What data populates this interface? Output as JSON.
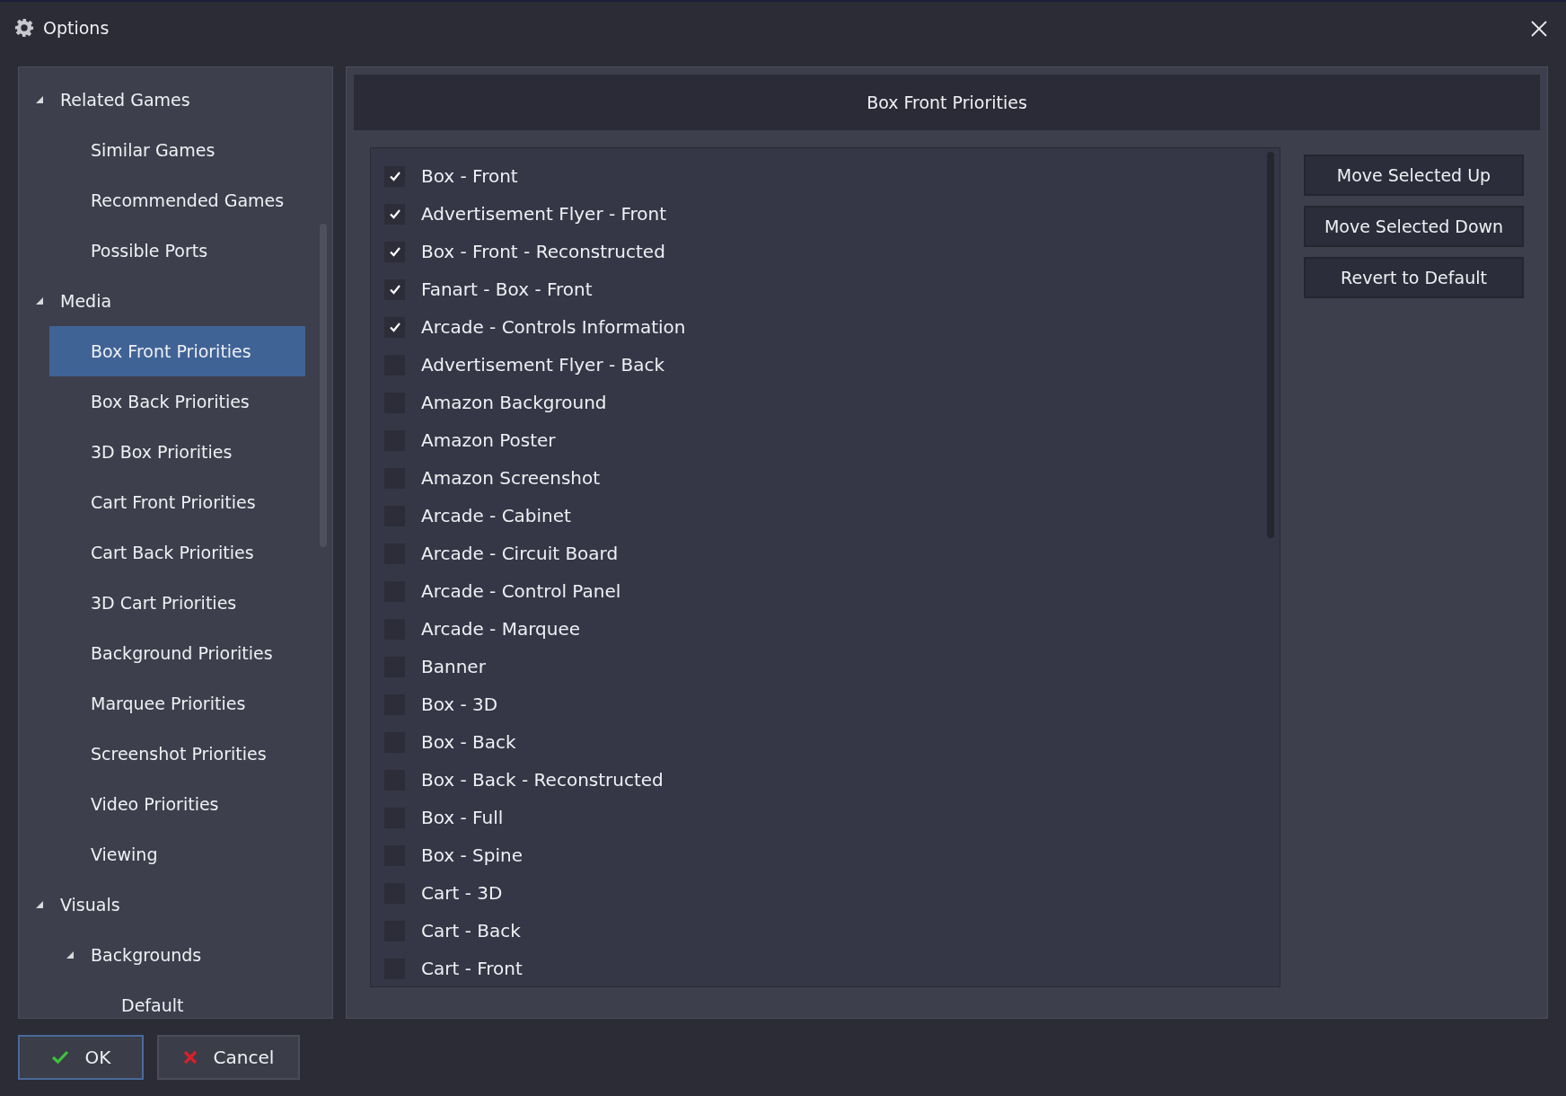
{
  "window": {
    "title": "Options"
  },
  "tree": [
    {
      "label": "Related Games",
      "expanded": true,
      "selected": false,
      "children": [
        {
          "label": "Similar Games",
          "selected": false
        },
        {
          "label": "Recommended Games",
          "selected": false
        },
        {
          "label": "Possible Ports",
          "selected": false
        }
      ]
    },
    {
      "label": "Media",
      "expanded": true,
      "selected": false,
      "children": [
        {
          "label": "Box Front Priorities",
          "selected": true
        },
        {
          "label": "Box Back Priorities",
          "selected": false
        },
        {
          "label": "3D Box Priorities",
          "selected": false
        },
        {
          "label": "Cart Front Priorities",
          "selected": false
        },
        {
          "label": "Cart Back Priorities",
          "selected": false
        },
        {
          "label": "3D Cart Priorities",
          "selected": false
        },
        {
          "label": "Background Priorities",
          "selected": false
        },
        {
          "label": "Marquee Priorities",
          "selected": false
        },
        {
          "label": "Screenshot Priorities",
          "selected": false
        },
        {
          "label": "Video Priorities",
          "selected": false
        },
        {
          "label": "Viewing",
          "selected": false
        }
      ]
    },
    {
      "label": "Visuals",
      "expanded": true,
      "selected": false,
      "children": [
        {
          "label": "Backgrounds",
          "expanded": true,
          "selected": false,
          "children": [
            {
              "label": "Default",
              "selected": false
            }
          ]
        }
      ]
    }
  ],
  "panel_title": "Box Front Priorities",
  "items": [
    {
      "label": "Box - Front",
      "checked": true
    },
    {
      "label": "Advertisement Flyer - Front",
      "checked": true
    },
    {
      "label": "Box - Front - Reconstructed",
      "checked": true
    },
    {
      "label": "Fanart - Box - Front",
      "checked": true
    },
    {
      "label": "Arcade - Controls Information",
      "checked": true
    },
    {
      "label": "Advertisement Flyer - Back",
      "checked": false
    },
    {
      "label": "Amazon Background",
      "checked": false
    },
    {
      "label": "Amazon Poster",
      "checked": false
    },
    {
      "label": "Amazon Screenshot",
      "checked": false
    },
    {
      "label": "Arcade - Cabinet",
      "checked": false
    },
    {
      "label": "Arcade - Circuit Board",
      "checked": false
    },
    {
      "label": "Arcade - Control Panel",
      "checked": false
    },
    {
      "label": "Arcade - Marquee",
      "checked": false
    },
    {
      "label": "Banner",
      "checked": false
    },
    {
      "label": "Box - 3D",
      "checked": false
    },
    {
      "label": "Box - Back",
      "checked": false
    },
    {
      "label": "Box - Back - Reconstructed",
      "checked": false
    },
    {
      "label": "Box - Full",
      "checked": false
    },
    {
      "label": "Box - Spine",
      "checked": false
    },
    {
      "label": "Cart - 3D",
      "checked": false
    },
    {
      "label": "Cart - Back",
      "checked": false
    },
    {
      "label": "Cart - Front",
      "checked": false
    }
  ],
  "side_buttons": [
    "Move Selected Up",
    "Move Selected Down",
    "Revert to Default"
  ],
  "footer_buttons": [
    {
      "label": "OK",
      "kind": "ok"
    },
    {
      "label": "Cancel",
      "kind": "cancel"
    }
  ]
}
